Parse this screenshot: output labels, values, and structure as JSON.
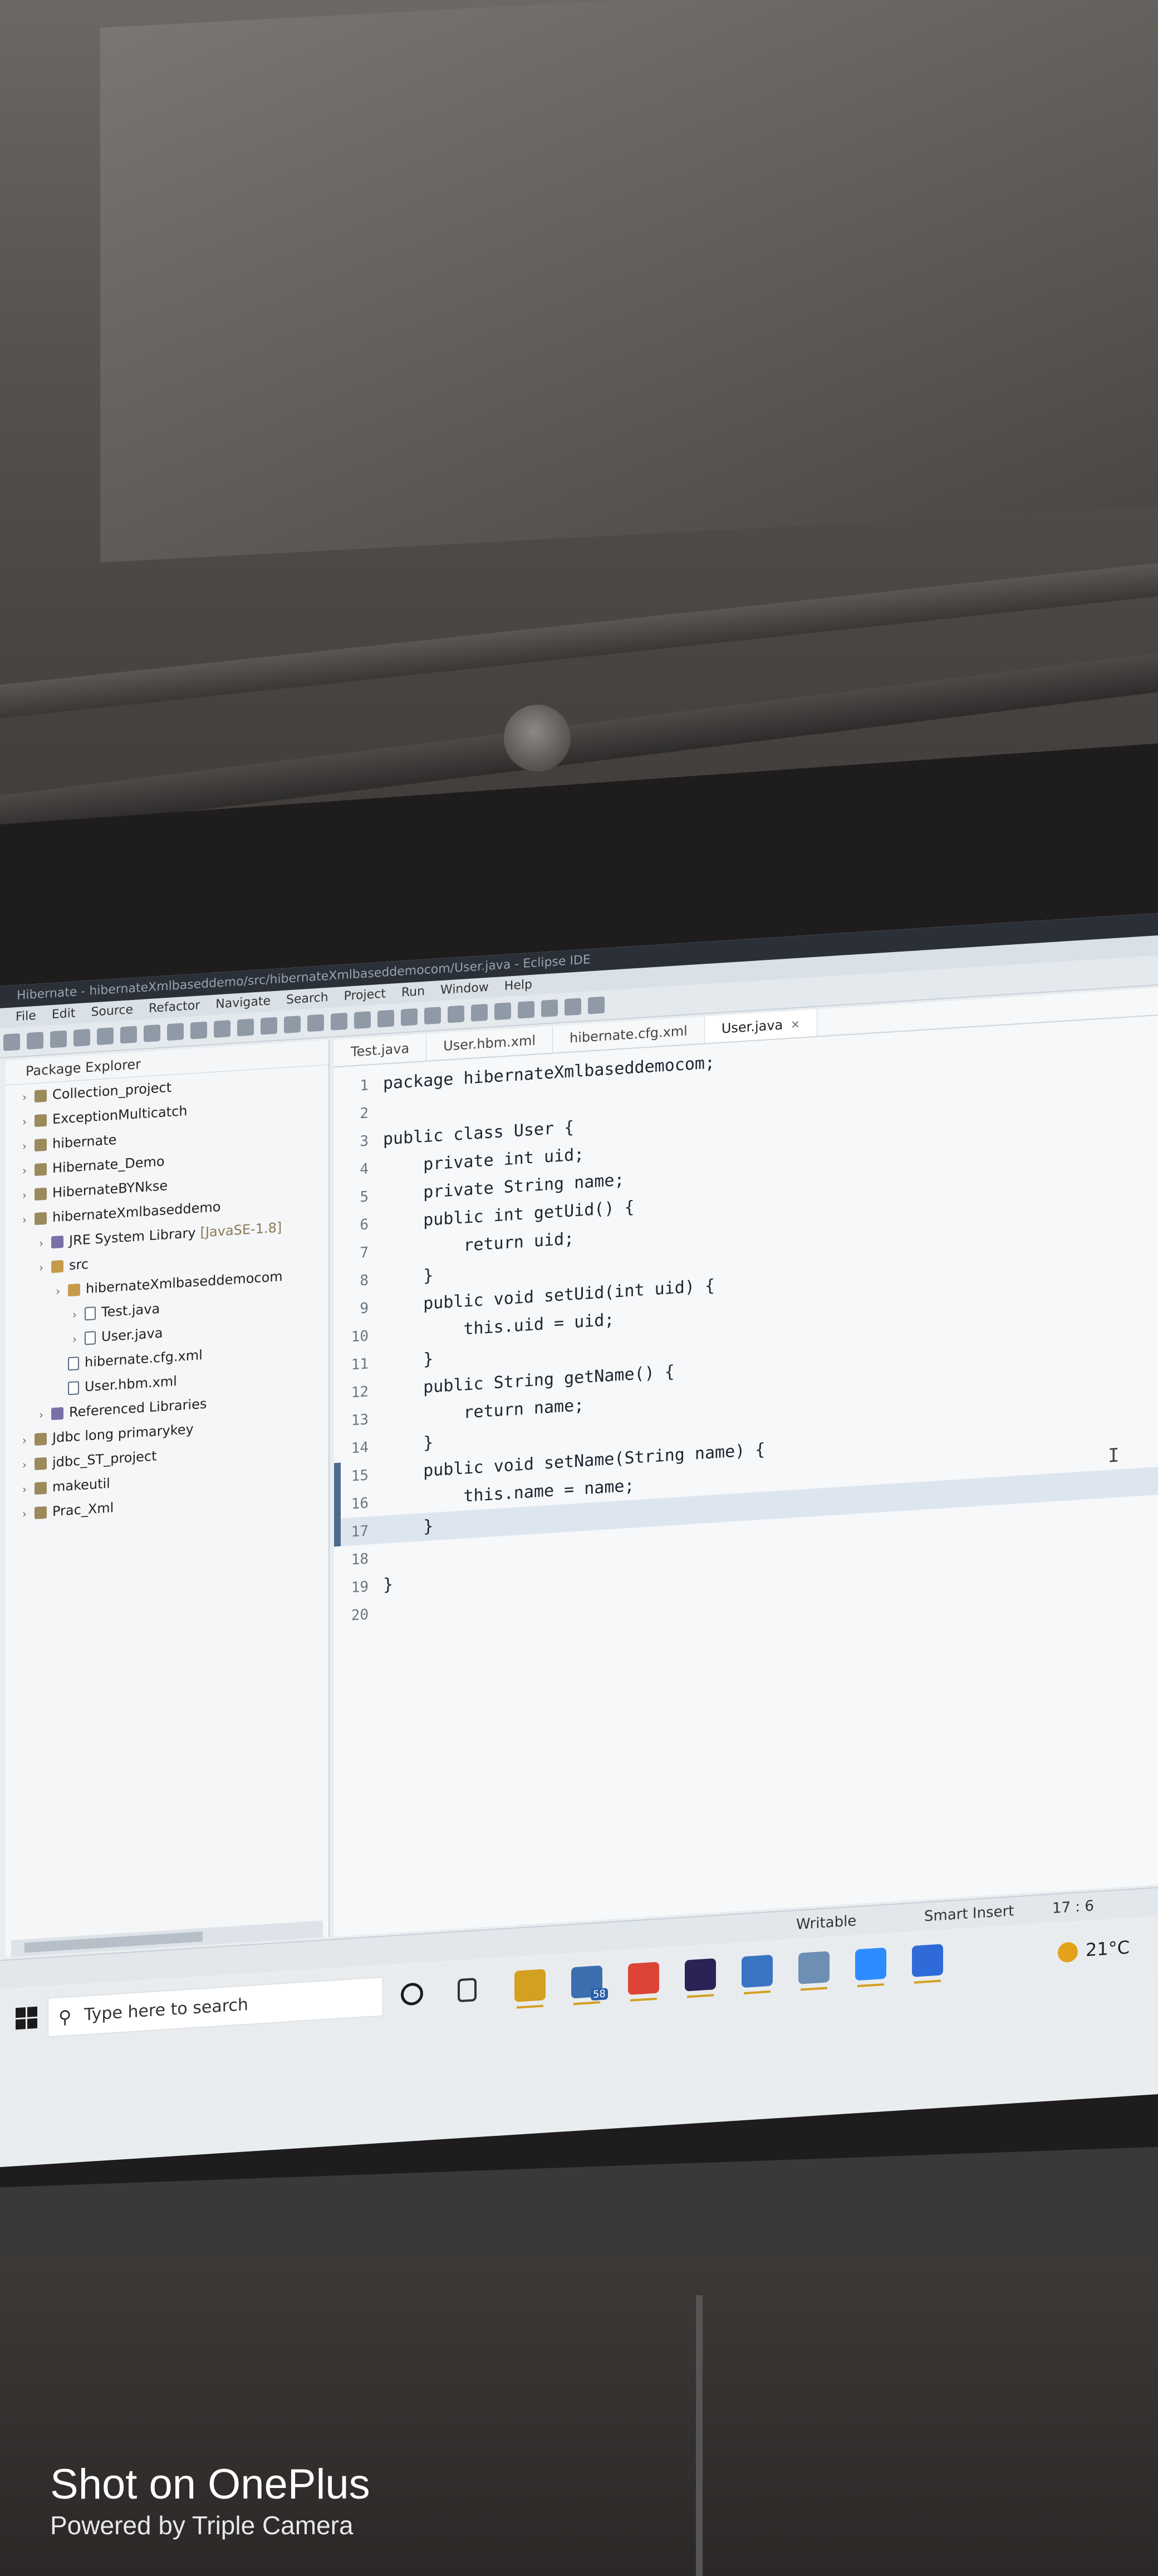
{
  "window": {
    "title": "Hibernate - hibernateXmlbaseddemo/src/hibernateXmlbaseddemocom/User.java - Eclipse IDE",
    "menu": [
      "File",
      "Edit",
      "Source",
      "Refactor",
      "Navigate",
      "Search",
      "Project",
      "Run",
      "Window",
      "Help"
    ]
  },
  "explorer": {
    "title": "Package Explorer",
    "items": [
      {
        "label": "Collection_project"
      },
      {
        "label": "ExceptionMulticatch"
      },
      {
        "label": "hibernate"
      },
      {
        "label": "Hibernate_Demo"
      },
      {
        "label": "HibernateBYNkse"
      },
      {
        "label": "hibernateXmlbaseddemo"
      },
      {
        "label": "JRE System Library",
        "suffix": "[JavaSE-1.8]"
      },
      {
        "label": "src"
      },
      {
        "label": "hibernateXmlbaseddemocom"
      },
      {
        "label": "Test.java"
      },
      {
        "label": "User.java"
      },
      {
        "label": "hibernate.cfg.xml"
      },
      {
        "label": "User.hbm.xml"
      },
      {
        "label": "Referenced Libraries"
      },
      {
        "label": "Jdbc long primarykey"
      },
      {
        "label": "jdbc_ST_project"
      },
      {
        "label": "makeutil"
      },
      {
        "label": "Prac_Xml"
      }
    ]
  },
  "editor": {
    "tabs": [
      "Test.java",
      "User.hbm.xml",
      "hibernate.cfg.xml",
      "User.java"
    ],
    "active_tab": "User.java",
    "lines": [
      {
        "n": "1",
        "code": "package hibernateXmlbaseddemocom;"
      },
      {
        "n": "2",
        "code": ""
      },
      {
        "n": "3",
        "code": "public class User {"
      },
      {
        "n": "4",
        "code": "    private int uid;"
      },
      {
        "n": "5",
        "code": "    private String name;"
      },
      {
        "n": "6",
        "code": "    public int getUid() {"
      },
      {
        "n": "7",
        "code": "        return uid;"
      },
      {
        "n": "8",
        "code": "    }"
      },
      {
        "n": "9",
        "code": "    public void setUid(int uid) {"
      },
      {
        "n": "10",
        "code": "        this.uid = uid;"
      },
      {
        "n": "11",
        "code": "    }"
      },
      {
        "n": "12",
        "code": "    public String getName() {"
      },
      {
        "n": "13",
        "code": "        return name;"
      },
      {
        "n": "14",
        "code": "    }"
      },
      {
        "n": "15",
        "code": "    public void setName(String name) {"
      },
      {
        "n": "16",
        "code": "        this.name = name;"
      },
      {
        "n": "17",
        "code": "    }"
      },
      {
        "n": "18",
        "code": ""
      },
      {
        "n": "19",
        "code": "}"
      },
      {
        "n": "20",
        "code": ""
      }
    ],
    "current_line": 17
  },
  "status": {
    "mode": "Writable",
    "insert": "Smart Insert",
    "position": "17 : 6"
  },
  "taskbar": {
    "search_placeholder": "Type here to search",
    "badge_count": "58",
    "weather": "21°C",
    "apps": [
      "cortana-icon",
      "task-view-icon",
      "file-explorer-icon",
      "store-icon",
      "chrome-icon",
      "eclipse-icon",
      "photos-icon",
      "paint-icon",
      "zoom-icon",
      "app-icon"
    ]
  },
  "watermark": {
    "title": "Shot on OnePlus",
    "subtitle": "Powered by Triple Camera"
  }
}
